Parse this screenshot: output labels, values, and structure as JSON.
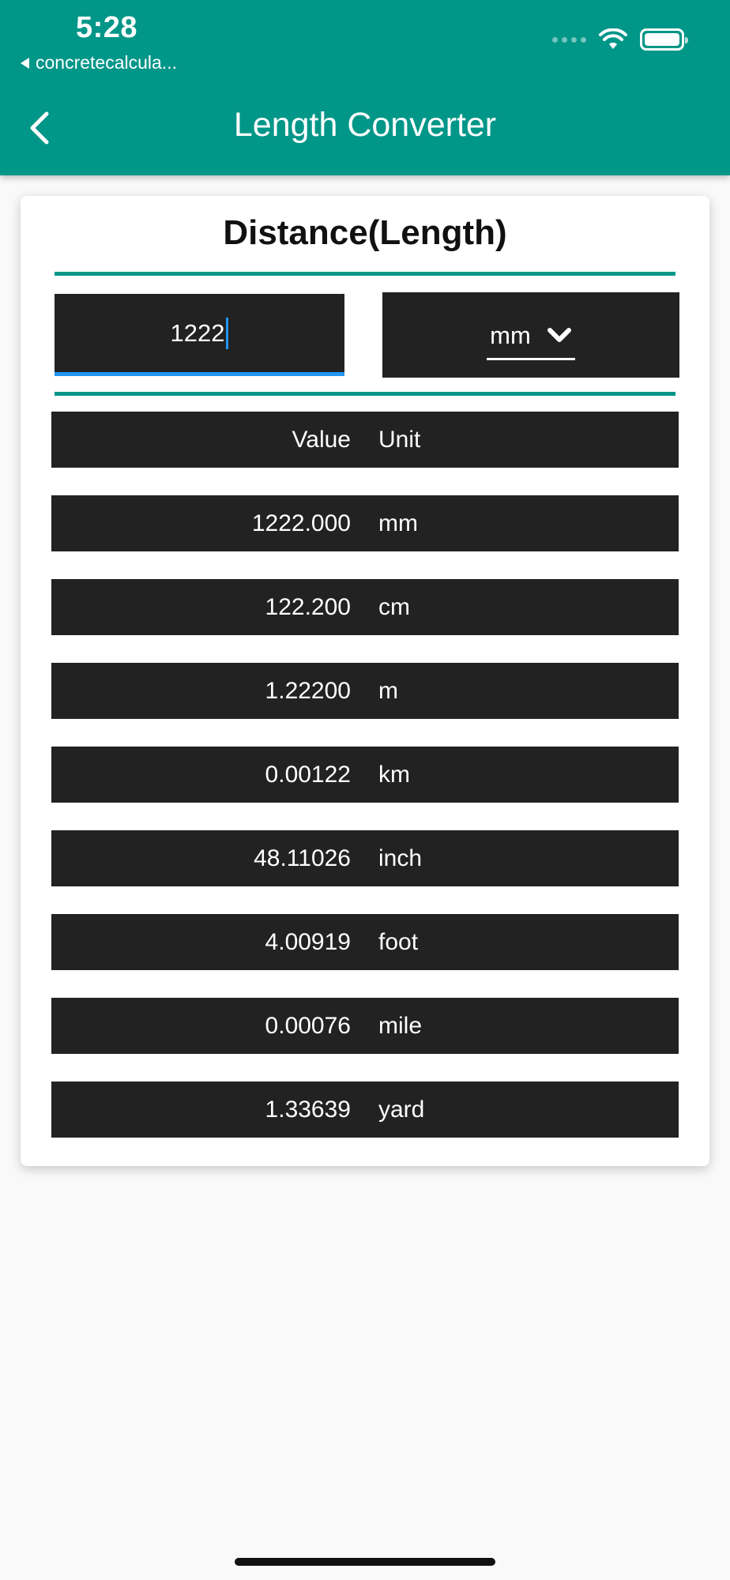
{
  "status": {
    "time": "5:28",
    "back_app": "concretecalcula..."
  },
  "appbar": {
    "title": "Length Converter"
  },
  "card": {
    "title": "Distance(Length)",
    "input_value": "1222",
    "unit_selected": "mm"
  },
  "table": {
    "header": {
      "value": "Value",
      "unit": "Unit"
    },
    "rows": [
      {
        "value": "1222.000",
        "unit": "mm"
      },
      {
        "value": "122.200",
        "unit": "cm"
      },
      {
        "value": "1.22200",
        "unit": "m"
      },
      {
        "value": "0.00122",
        "unit": "km"
      },
      {
        "value": "48.11026",
        "unit": "inch"
      },
      {
        "value": "4.00919",
        "unit": "foot"
      },
      {
        "value": "0.00076",
        "unit": "mile"
      },
      {
        "value": "1.33639",
        "unit": "yard"
      }
    ]
  },
  "colors": {
    "accent": "#009688",
    "dark": "#222222",
    "focus": "#2196f3"
  },
  "icons": [
    "back-arrow-icon",
    "wifi-icon",
    "battery-icon",
    "signal-icon",
    "chevron-down-icon"
  ]
}
